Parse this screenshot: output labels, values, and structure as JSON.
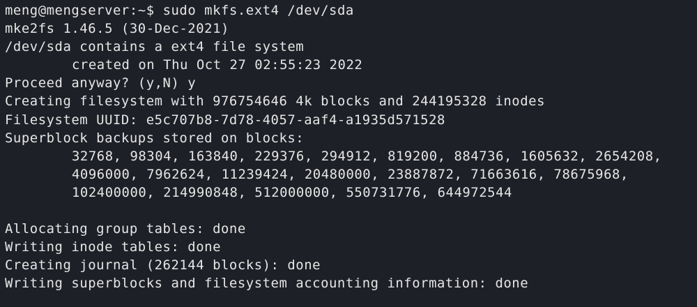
{
  "terminal": {
    "background": "#1e2027",
    "foreground": "#e6e6e6",
    "prompt": "meng@mengserver:~$",
    "command": "sudo mkfs.ext4 /dev/sda",
    "lines": [
      "mke2fs 1.46.5 (30-Dec-2021)",
      "/dev/sda contains a ext4 file system",
      "created on Thu Oct 27 02:55:23 2022",
      "Proceed anyway? (y,N) y",
      "Creating filesystem with 976754646 4k blocks and 244195328 inodes",
      "Filesystem UUID: e5c707b8-7d78-4057-aaf4-a1935d571528",
      "Superblock backups stored on blocks:",
      "32768, 98304, 163840, 229376, 294912, 819200, 884736, 1605632, 2654208,",
      "4096000, 7962624, 11239424, 20480000, 23887872, 71663616, 78675968,",
      "102400000, 214990848, 512000000, 550731776, 644972544",
      "",
      "Allocating group tables: done",
      "Writing inode tables: done",
      "Creating journal (262144 blocks): done",
      "Writing superblocks and filesystem accounting information: done"
    ]
  }
}
